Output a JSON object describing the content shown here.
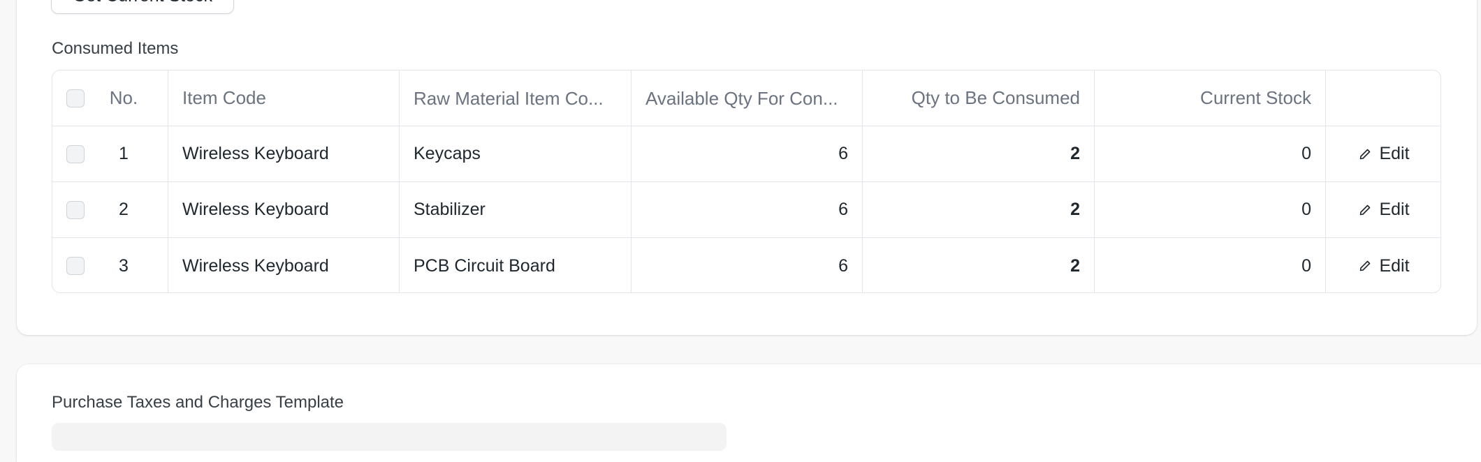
{
  "toolbar": {
    "get_stock_label": "Get Current Stock"
  },
  "consumed_items": {
    "section_label": "Consumed Items",
    "columns": {
      "no": "No.",
      "item_code": "Item Code",
      "raw_material": "Raw Material Item Co...",
      "available_qty": "Available Qty For Con...",
      "qty_consumed": "Qty to Be Consumed",
      "current_stock": "Current Stock"
    },
    "rows": [
      {
        "no": "1",
        "item_code": "Wireless Keyboard",
        "raw_material": "Keycaps",
        "available_qty": "6",
        "qty_consumed": "2",
        "current_stock": "0",
        "edit": "Edit"
      },
      {
        "no": "2",
        "item_code": "Wireless Keyboard",
        "raw_material": "Stabilizer",
        "available_qty": "6",
        "qty_consumed": "2",
        "current_stock": "0",
        "edit": "Edit"
      },
      {
        "no": "3",
        "item_code": "Wireless Keyboard",
        "raw_material": "PCB Circuit Board",
        "available_qty": "6",
        "qty_consumed": "2",
        "current_stock": "0",
        "edit": "Edit"
      }
    ]
  },
  "taxes": {
    "section_label": "Purchase Taxes and Charges Template"
  },
  "icons": {
    "edit": "pencil-icon",
    "checkbox": "checkbox-icon"
  }
}
